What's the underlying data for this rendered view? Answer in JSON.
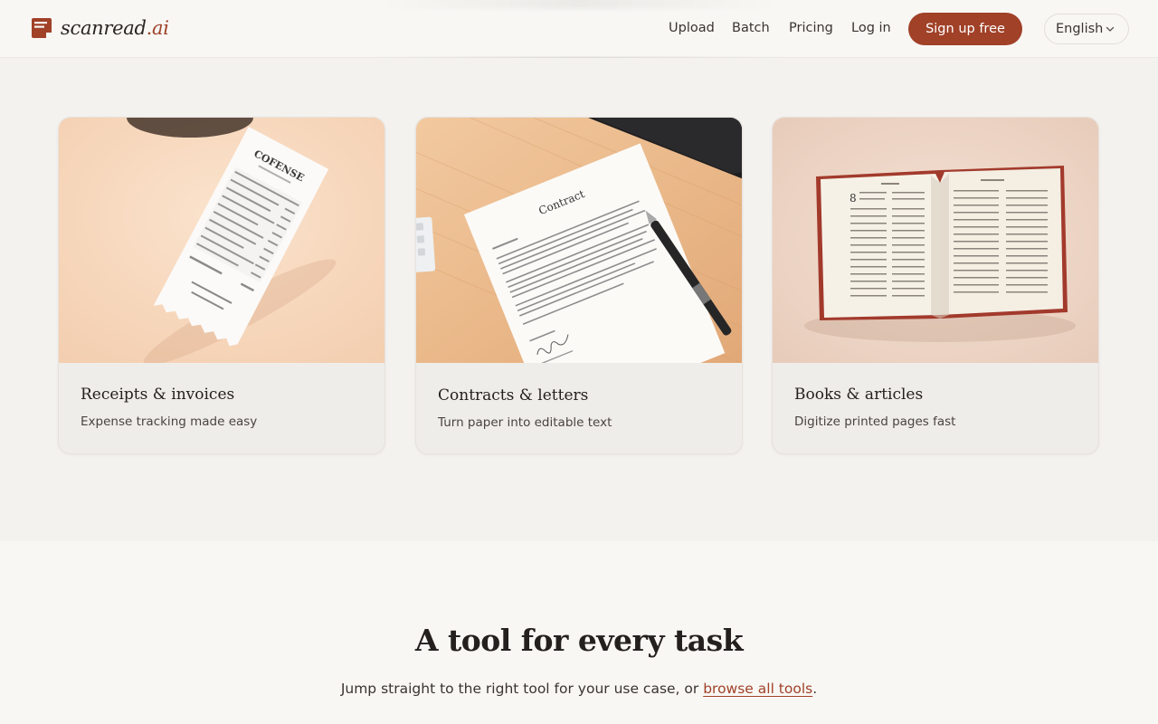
{
  "brand": {
    "name_prefix": "scanread",
    "name_suffix": ".ai",
    "accent_color": "#a04128"
  },
  "nav": {
    "links": [
      "Upload",
      "Batch",
      "Pricing",
      "Log in"
    ],
    "signup_label": "Sign up free",
    "language": "English"
  },
  "cards": [
    {
      "title": "Receipts & invoices",
      "description": "Expense tracking made easy",
      "image": "receipt-photo",
      "receipt_heading": "COFENSE"
    },
    {
      "title": "Contracts & letters",
      "description": "Turn paper into editable text",
      "image": "contract-photo",
      "doc_heading": "Contract"
    },
    {
      "title": "Books & articles",
      "description": "Digitize printed pages fast",
      "image": "open-book-photo",
      "page_number": "8"
    }
  ],
  "tools_section": {
    "title": "A tool for every task",
    "subtitle_before": "Jump straight to the right tool for your use case, or ",
    "subtitle_link": "browse all tools",
    "subtitle_after": "."
  }
}
